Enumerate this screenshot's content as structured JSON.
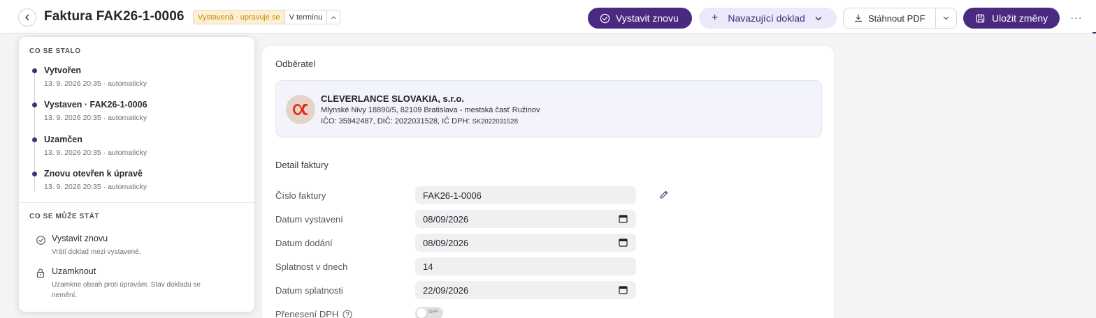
{
  "header": {
    "title": "Faktura FAK26-1-0006",
    "status": "Vystavená · upravuje se",
    "term_status": "V termínu",
    "reissue_label": "Vystavit znovu",
    "follow_doc_label": "Navazující doklad",
    "download_label": "Stáhnout PDF",
    "save_label": "Uložit změny",
    "more_label": "···"
  },
  "history": {
    "title": "CO SE STALO",
    "items": [
      {
        "title": "Vytvořen",
        "meta": "13. 9. 2026 20:35 · automaticky"
      },
      {
        "title": "Vystaven · FAK26-1-0006",
        "meta": "13. 9. 2026 20:35 · automaticky"
      },
      {
        "title": "Uzamčen",
        "meta": "13. 9. 2026 20:35 · automaticky"
      },
      {
        "title": "Znovu otevřen k úpravě",
        "meta": "13. 9. 2026 20:35 · automaticky"
      }
    ]
  },
  "possible": {
    "title": "CO SE MŮŽE STÁT",
    "actions": [
      {
        "title": "Vystavit znovu",
        "desc": "Vrátí doklad mezi vystavené.",
        "icon": "check-circle-icon"
      },
      {
        "title": "Uzamknout",
        "desc": "Uzamkne obsah proti úpravám. Stav dokladu se nemění.",
        "icon": "lock-icon"
      }
    ]
  },
  "customer": {
    "section_label": "Odběratel",
    "name": "CLEVERLANCE SLOVAKIA, s.r.o.",
    "address": "Mlynské Nivy 18890/5, 82109 Bratislava - mestská časť Ružinov",
    "ids": "IČO: 35942487, DIČ: 2022031528, IČ DPH: ",
    "vat_id": "SK2022031528"
  },
  "detail": {
    "section_label": "Detail faktury",
    "invoice_number_label": "Číslo faktury",
    "invoice_number": "FAK26-1-0006",
    "issue_date_label": "Datum vystavení",
    "issue_date": "08/09/2026",
    "delivery_date_label": "Datum dodání",
    "delivery_date": "08/09/2026",
    "due_days_label": "Splatnost v dnech",
    "due_days": "14",
    "due_date_label": "Datum splatnosti",
    "due_date": "22/09/2026",
    "reverse_charge_label": "Přenesení DPH",
    "reverse_charge_state": "OFF"
  },
  "colors": {
    "primary": "#4a2a80",
    "status_badge_bg": "#fdefcf",
    "status_badge_text": "#c08a18",
    "follow_btn_bg": "#ece9fb",
    "customer_box_bg": "#f3f4fb"
  }
}
